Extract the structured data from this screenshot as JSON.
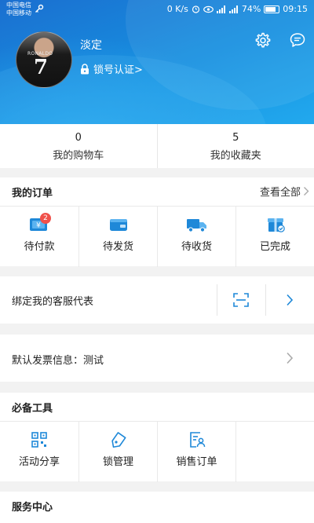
{
  "status_bar": {
    "carrier_1": "中国电信",
    "carrier_2": "中国移动",
    "speed": "0 K/s",
    "battery": "74%",
    "time": "09:15"
  },
  "profile": {
    "username": "淡定",
    "certification": "锁号认证>",
    "avatar_shirt_text": "RONALDO",
    "avatar_shirt_number": "7"
  },
  "counts": [
    {
      "value": "0",
      "label": "我的购物车"
    },
    {
      "value": "5",
      "label": "我的收藏夹"
    }
  ],
  "orders": {
    "title": "我的订单",
    "view_all": "查看全部",
    "items": [
      {
        "label": "待付款",
        "icon": "pending-payment-icon",
        "badge": "2"
      },
      {
        "label": "待发货",
        "icon": "wallet-icon"
      },
      {
        "label": "待收货",
        "icon": "truck-icon"
      },
      {
        "label": "已完成",
        "icon": "gift-check-icon"
      }
    ]
  },
  "service_rep": {
    "label": "绑定我的客服代表"
  },
  "invoice": {
    "label": "默认发票信息：测试"
  },
  "tools": {
    "title": "必备工具",
    "items": [
      {
        "label": "活动分享",
        "icon": "qr-code-icon"
      },
      {
        "label": "锁管理",
        "icon": "tag-icon"
      },
      {
        "label": "销售订单",
        "icon": "order-person-icon"
      }
    ]
  },
  "service_center": {
    "title": "服务中心"
  },
  "colors": {
    "accent": "#1e88d8",
    "header_top": "#1b6fd0",
    "header_bottom": "#22a9ee",
    "badge": "#f0504a"
  }
}
